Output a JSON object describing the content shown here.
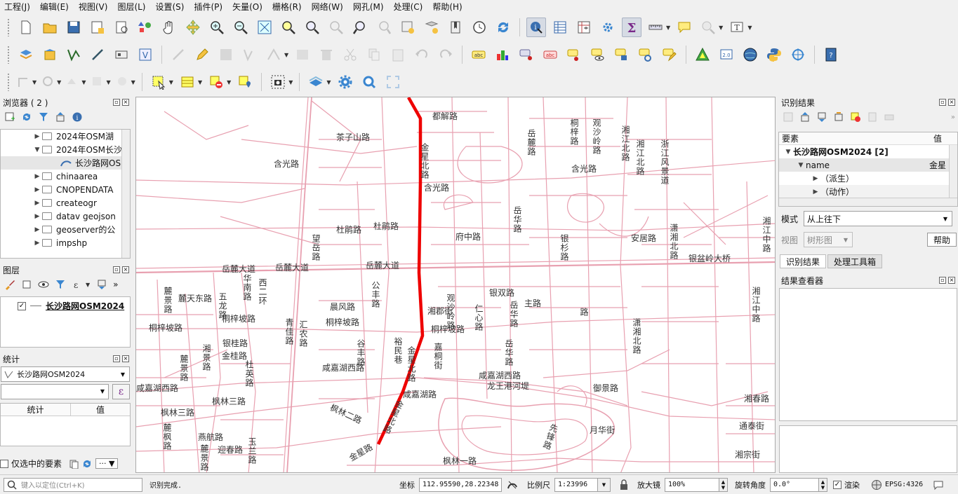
{
  "menu": [
    "工程(J)",
    "编辑(E)",
    "视图(V)",
    "图层(L)",
    "设置(S)",
    "插件(P)",
    "矢量(O)",
    "栅格(R)",
    "网络(W)",
    "网孔(M)",
    "处理(C)",
    "帮助(H)"
  ],
  "browser": {
    "title": "浏览器 ( 2 )",
    "items": [
      "2024年OSM湖",
      "2024年OSM长沙",
      "长沙路网OS",
      "chinaarea",
      "CNOPENDATA",
      "createogr",
      "datav geojson",
      "geoserver的公",
      "impshp"
    ]
  },
  "layers": {
    "title": "图层",
    "layer_name": "长沙路网OSM2024"
  },
  "stats": {
    "title": "统计",
    "layer": "长沙路网OSM2024",
    "col_stat": "统计",
    "col_value": "值",
    "selected_only": "仅选中的要素"
  },
  "identify": {
    "title": "识别结果",
    "col_feature": "要素",
    "col_value": "值",
    "layer_row": "长沙路网OSM2024  [2]",
    "attr_name": "name",
    "attr_value": "金星",
    "derived": "（派生）",
    "actions": "（动作）",
    "mode_label": "模式",
    "mode_value": "从上往下",
    "view_label": "视图",
    "view_value": "树形图",
    "help": "帮助",
    "tab1": "识别结果",
    "tab2": "处理工具箱"
  },
  "viewer": {
    "title": "结果查看器"
  },
  "map_labels": {
    "h": [
      {
        "t": "都解路"
      },
      {
        "t": "茶子山路"
      },
      {
        "t": "含光路"
      },
      {
        "t": "含光路"
      },
      {
        "t": "含光路"
      },
      {
        "t": "杜鹃路"
      },
      {
        "t": "杜鹃路"
      },
      {
        "t": "府中路"
      },
      {
        "t": "安居路"
      },
      {
        "t": "岳麓大道"
      },
      {
        "t": "岳麓大道"
      },
      {
        "t": "岳麓大道"
      },
      {
        "t": "银盆岭大桥"
      },
      {
        "t": "麓天东路"
      },
      {
        "t": "银双路"
      },
      {
        "t": "主路"
      },
      {
        "t": "湘郡街"
      },
      {
        "t": "晨风路"
      },
      {
        "t": "桐梓坡路"
      },
      {
        "t": "桐梓坡路"
      },
      {
        "t": "桐梓坡路"
      },
      {
        "t": "桐梓坡路"
      },
      {
        "t": "银桂路"
      },
      {
        "t": "金桂路"
      },
      {
        "t": "咸嘉湖西路"
      },
      {
        "t": "咸嘉湖西路"
      },
      {
        "t": "咸嘉湖西路"
      },
      {
        "t": "龙王港河堤"
      },
      {
        "t": "咸嘉湖路"
      },
      {
        "t": "御景路"
      },
      {
        "t": "枫林三路"
      },
      {
        "t": "枫林三路"
      },
      {
        "t": "枫林二路"
      },
      {
        "t": "燕航路"
      },
      {
        "t": "迎春路"
      },
      {
        "t": "月华街"
      },
      {
        "t": "枫林一路"
      },
      {
        "t": "湘春路"
      },
      {
        "t": "通泰街"
      },
      {
        "t": "湘宗街"
      },
      {
        "t": "金星路"
      }
    ],
    "v": [
      {
        "t": "金星北路"
      },
      {
        "t": "岳麓路"
      },
      {
        "t": "观沙岭路"
      },
      {
        "t": "桐梓路"
      },
      {
        "t": "湘江北路"
      },
      {
        "t": "湘江北路"
      },
      {
        "t": "浙江风景道"
      },
      {
        "t": "望岳路"
      },
      {
        "t": "岳华路"
      },
      {
        "t": "银杉路"
      },
      {
        "t": "潇湘北路"
      },
      {
        "t": "潇湘北路"
      },
      {
        "t": "湘江中路"
      },
      {
        "t": "湘江中路"
      },
      {
        "t": "麓景路"
      },
      {
        "t": "五龙路"
      },
      {
        "t": "华南路"
      },
      {
        "t": "西二环"
      },
      {
        "t": "公丰路"
      },
      {
        "t": "谷丰路"
      },
      {
        "t": "湘景路"
      },
      {
        "t": "观沙岭路"
      },
      {
        "t": "岳华路"
      },
      {
        "t": "嘉桐街"
      },
      {
        "t": "岳华路"
      },
      {
        "t": "杜英路"
      },
      {
        "t": "麓景路"
      },
      {
        "t": "麓枫路"
      },
      {
        "t": "麓景路"
      },
      {
        "t": "金星北路"
      },
      {
        "t": "青佳路"
      },
      {
        "t": "金星北路"
      },
      {
        "t": "裕民巷"
      },
      {
        "t": "先锋路"
      },
      {
        "t": "玉兰路"
      },
      {
        "t": "汇农路"
      },
      {
        "t": "仁心路"
      },
      {
        "t": "路"
      }
    ]
  },
  "status": {
    "locate_placeholder": "键入以定位(Ctrl+K)",
    "message": "识别完成.",
    "coord_label": "坐标",
    "coord": "112.95590,28.22348",
    "scale_label": "比例尺",
    "scale": "1:23996",
    "mag_label": "放大镜",
    "mag": "100%",
    "rot_label": "旋转角度",
    "rot": "0.0°",
    "render": "渲染",
    "crs": "EPSG:4326"
  },
  "colors": {
    "road": "#e8a0b0",
    "highlight": "#ee0000",
    "panel": "#f0f0f0"
  }
}
